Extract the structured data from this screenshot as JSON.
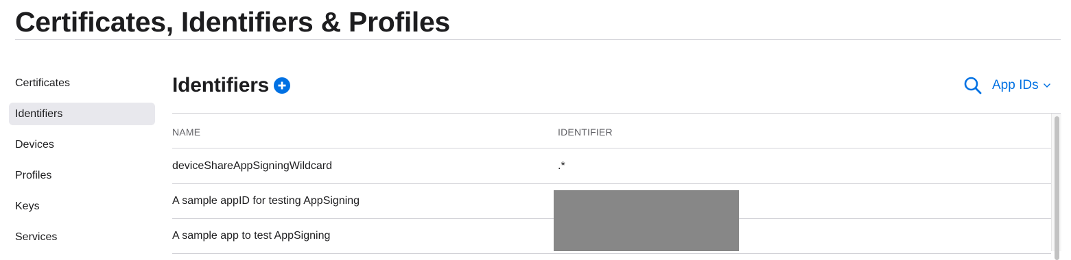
{
  "page": {
    "title": "Certificates, Identifiers & Profiles"
  },
  "sidebar": {
    "items": [
      {
        "label": "Certificates",
        "active": false
      },
      {
        "label": "Identifiers",
        "active": true
      },
      {
        "label": "Devices",
        "active": false
      },
      {
        "label": "Profiles",
        "active": false
      },
      {
        "label": "Keys",
        "active": false
      },
      {
        "label": "Services",
        "active": false
      }
    ]
  },
  "section": {
    "title": "Identifiers",
    "add_icon": "plus-circle-icon",
    "search_icon": "search-icon",
    "filter": {
      "label": "App IDs",
      "icon": "chevron-down-icon"
    }
  },
  "table": {
    "columns": [
      "NAME",
      "IDENTIFIER"
    ],
    "rows": [
      {
        "name": "deviceShareAppSigningWildcard",
        "identifier": ".*"
      },
      {
        "name": "A sample appID for testing AppSigning",
        "identifier": ""
      },
      {
        "name": "A sample app to test AppSigning",
        "identifier": ""
      }
    ]
  },
  "colors": {
    "accent": "#0071e3",
    "text": "#1d1d1f",
    "muted": "#5e5e63",
    "active_bg": "#e8e8ed",
    "divider": "#d2d2d7",
    "redaction": "#878787"
  }
}
